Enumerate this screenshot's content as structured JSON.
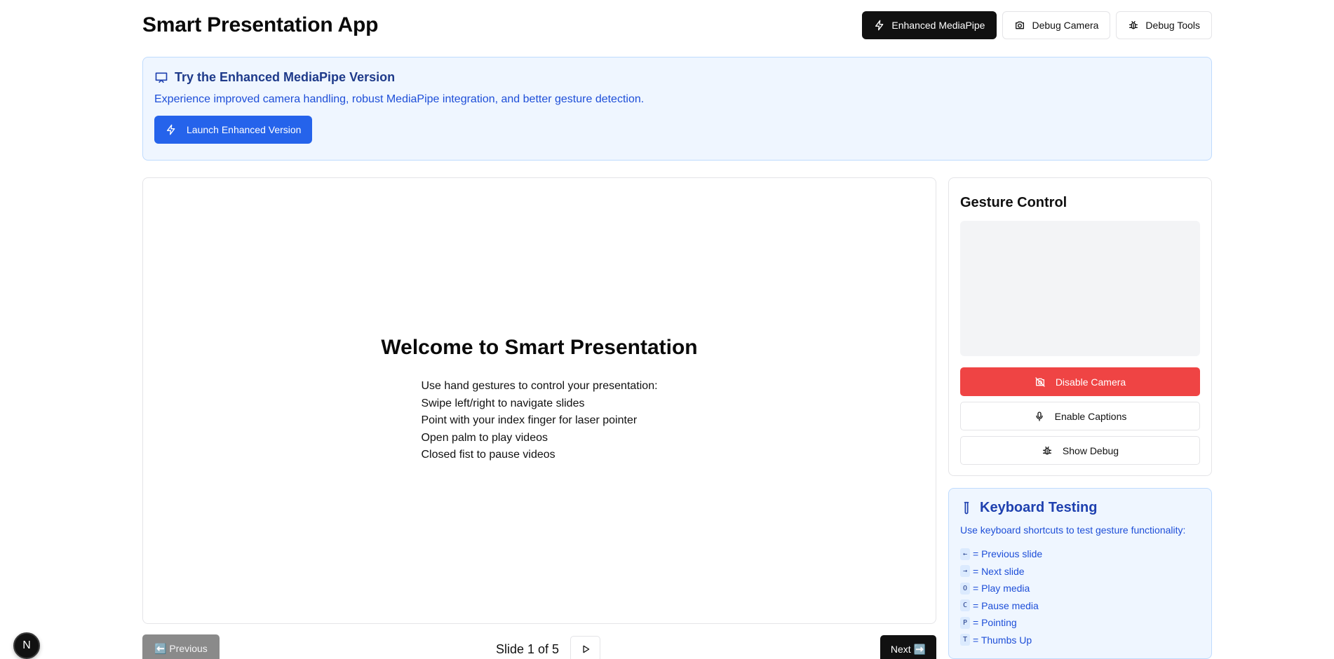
{
  "app": {
    "title": "Smart Presentation App"
  },
  "toolbar": {
    "enhanced_label": "Enhanced MediaPipe",
    "debug_camera_label": "Debug Camera",
    "debug_tools_label": "Debug Tools"
  },
  "promo": {
    "title": "Try the Enhanced MediaPipe Version",
    "description": "Experience improved camera handling, robust MediaPipe integration, and better gesture detection.",
    "button_label": "Launch Enhanced Version"
  },
  "slide": {
    "title": "Welcome to Smart Presentation",
    "lines": [
      "Use hand gestures to control your presentation:",
      "Swipe left/right to navigate slides",
      "Point with your index finger for laser pointer",
      "Open palm to play videos",
      "Closed fist to pause videos"
    ]
  },
  "navigation": {
    "previous_label": "⬅️ Previous",
    "slide_counter": "Slide 1 of 5",
    "next_label": "Next ➡️"
  },
  "gesture_panel": {
    "title": "Gesture Control",
    "disable_camera_label": "Disable Camera",
    "enable_captions_label": "Enable Captions",
    "show_debug_label": "Show Debug"
  },
  "keyboard_panel": {
    "title": "Keyboard Testing",
    "description": "Use keyboard shortcuts to test gesture functionality:",
    "shortcuts": [
      {
        "key": "←",
        "action": "= Previous slide"
      },
      {
        "key": "→",
        "action": "= Next slide"
      },
      {
        "key": "O",
        "action": "= Play media"
      },
      {
        "key": "C",
        "action": "= Pause media"
      },
      {
        "key": "P",
        "action": "= Pointing"
      },
      {
        "key": "T",
        "action": "= Thumbs Up"
      }
    ]
  },
  "badge": {
    "letter": "N"
  },
  "colors": {
    "primary_blue": "#2563eb",
    "danger_red": "#ef4444",
    "panel_blue_bg": "#eff6ff",
    "dark": "#111111"
  },
  "icons": {
    "enhanced": "lightning-icon",
    "debug_camera": "camera-icon",
    "debug_tools": "bug-icon",
    "promo": "presentation-icon",
    "disable_camera": "camera-off-icon",
    "captions": "microphone-icon",
    "debug": "bug-icon",
    "keyboard": "test-tube-icon",
    "play": "play-icon"
  }
}
